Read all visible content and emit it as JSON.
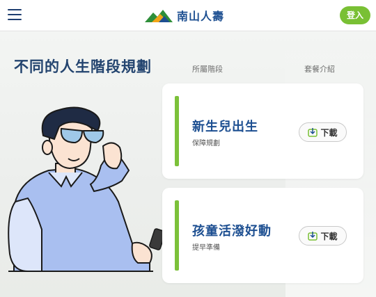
{
  "header": {
    "brand": "南山人壽",
    "login_label": "登入"
  },
  "main": {
    "title": "不同的人生階段規劃",
    "columns": [
      "所屬階段",
      "套餐介紹"
    ],
    "cards": [
      {
        "stage": "新生兒出生",
        "subtitle": "保障規劃",
        "download_label": "下載"
      },
      {
        "stage": "孩童活潑好動",
        "subtitle": "提早準備",
        "download_label": "下載"
      }
    ]
  },
  "colors": {
    "brand_blue": "#1d4f91",
    "accent_green": "#79c034",
    "title_navy": "#23446f"
  },
  "icons": [
    "hamburger-menu-icon",
    "mountain-logo-icon",
    "download-icon"
  ]
}
